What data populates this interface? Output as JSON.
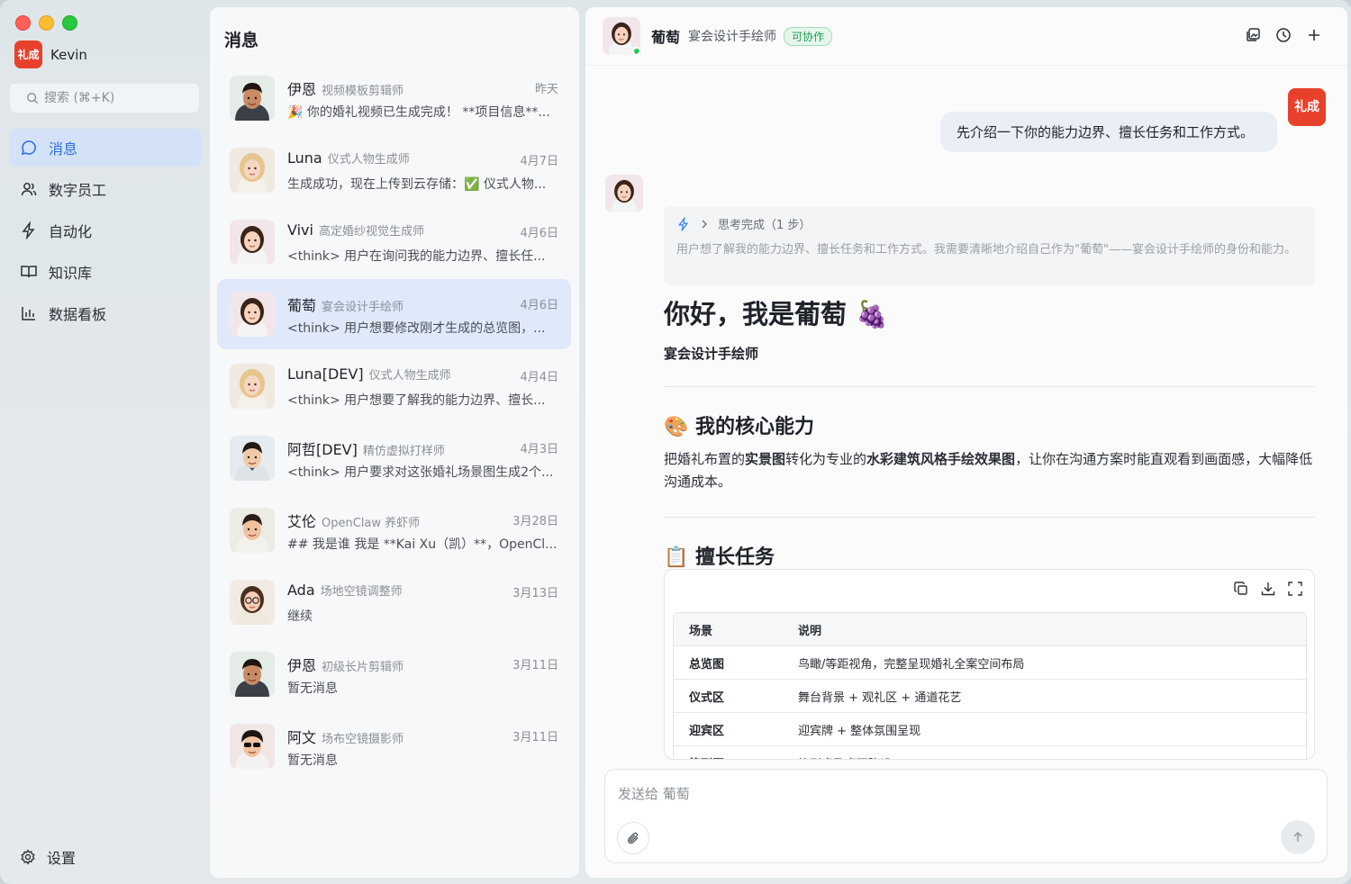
{
  "sidebar": {
    "brand_logo": "礼成",
    "user_name": "Kevin",
    "search_placeholder": "搜索 (⌘+K)",
    "nav": [
      {
        "label": "消息",
        "icon": "chat-bubble-icon",
        "active": true
      },
      {
        "label": "数字员工",
        "icon": "users-icon"
      },
      {
        "label": "自动化",
        "icon": "lightning-icon"
      },
      {
        "label": "知识库",
        "icon": "book-icon"
      },
      {
        "label": "数据看板",
        "icon": "bar-chart-icon"
      }
    ],
    "settings_label": "设置"
  },
  "list": {
    "title": "消息",
    "items": [
      {
        "name": "伊恩",
        "role": "视频模板剪辑师",
        "date": "昨天",
        "msg": "🎉 你的婚礼视频已生成完成！ **项目信息**...",
        "avatar": "man-1"
      },
      {
        "name": "Luna",
        "role": "仪式人物生成师",
        "date": "4月7日",
        "msg": "生成成功，现在上传到云存储：✅ 仪式人物...",
        "avatar": "woman-blonde"
      },
      {
        "name": "Vivi",
        "role": "高定婚纱视觉生成师",
        "date": "4月6日",
        "msg": "<think> 用户在询问我的能力边界、擅长任...",
        "avatar": "woman-dark"
      },
      {
        "name": "葡萄",
        "role": "宴会设计手绘师",
        "date": "4月6日",
        "msg": "<think> 用户想要修改刚才生成的总览图，...",
        "avatar": "woman-dark",
        "active": true
      },
      {
        "name": "Luna[DEV]",
        "role": "仪式人物生成师",
        "date": "4月4日",
        "msg": "<think> 用户想要了解我的能力边界、擅长...",
        "avatar": "woman-blonde"
      },
      {
        "name": "阿哲[DEV]",
        "role": "精仿虚拟打样师",
        "date": "4月3日",
        "msg": "<think> 用户要求对这张婚礼场景图生成2个...",
        "avatar": "man-2"
      },
      {
        "name": "艾伦",
        "role": "OpenClaw 养虾师",
        "date": "3月28日",
        "msg": "## 我是谁 我是 **Kai Xu（凯）**，OpenCl...",
        "avatar": "man-3"
      },
      {
        "name": "Ada",
        "role": "场地空镜调整师",
        "date": "3月13日",
        "msg": "继续",
        "avatar": "woman-glasses"
      },
      {
        "name": "伊恩",
        "role": "初级长片剪辑师",
        "date": "3月11日",
        "msg": "暂无消息",
        "avatar": "man-1"
      },
      {
        "name": "阿文",
        "role": "场布空镜摄影师",
        "date": "3月11日",
        "msg": "暂无消息",
        "avatar": "man-sunglasses"
      }
    ]
  },
  "chat": {
    "name": "葡萄",
    "role": "宴会设计手绘师",
    "badge": "可协作",
    "user_avatar_text": "礼成",
    "user_message": "先介绍一下你的能力边界、擅长任务和工作方式。",
    "think_label": "思考完成（1 步）",
    "think_text": "用户想了解我的能力边界、擅长任务和工作方式。我需要清晰地介绍自己作为\"葡萄\"——宴会设计手绘师的身份和能力。",
    "answer_title": "你好，我是葡萄 🍇",
    "answer_sub": "宴会设计手绘师",
    "section1_title": "🎨 我的核心能力",
    "section1_body": [
      "把婚礼布置的",
      "实景图",
      "转化为专业的",
      "水彩建筑风格手绘效果图",
      "，让你在沟通方案时能直观看到画面感，大幅降低沟通成本。"
    ],
    "section2_title": "📋 擅长任务",
    "table": {
      "headers": [
        "场景",
        "说明"
      ],
      "rows": [
        [
          "总览图",
          "鸟瞰/等距视角，完整呈现婚礼全案空间布局"
        ],
        [
          "仪式区",
          "舞台背景 + 观礼区 + 通道花艺"
        ],
        [
          "迎宾区",
          "迎宾牌 + 整体氛围呈现"
        ],
        [
          "签到区",
          "签到桌及桌面陈设"
        ]
      ]
    },
    "composer_placeholder": "发送给 葡萄"
  }
}
